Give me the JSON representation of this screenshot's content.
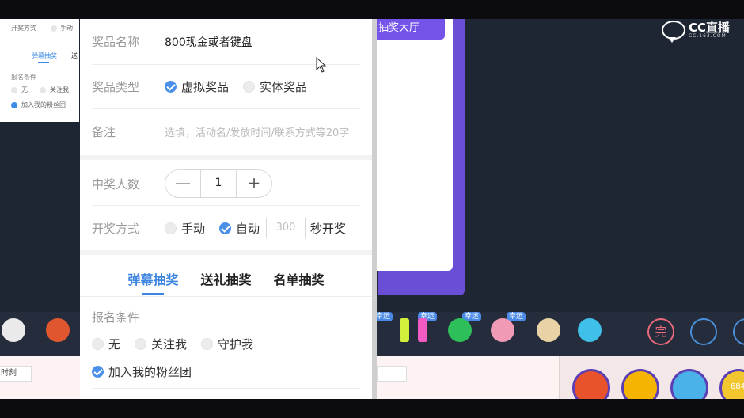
{
  "background_left": {
    "method_label": "开奖方式",
    "method_manual": "手动",
    "tab_active": "弹幕抽奖",
    "tab_next": "送",
    "cond_title": "报名条件",
    "cond_none": "无",
    "cond_follow": "关注我",
    "cond_fans": "加入我的粉丝团"
  },
  "background_right": {
    "hall_button": "抽奖大厅",
    "logo_brand": "CC直播",
    "logo_sub": "CC.163.COM"
  },
  "gift_strip": {
    "tags": [
      "幸运",
      "幸运",
      "幸运",
      "幸运",
      "幸运"
    ],
    "icon_wan": "完",
    "time_field": "时刻",
    "round_count": "684"
  },
  "modal": {
    "prize_name": {
      "label": "奖品名称",
      "value": "800现金或者键盘"
    },
    "prize_type": {
      "label": "奖品类型",
      "options": [
        "虚拟奖品",
        "实体奖品"
      ],
      "selected": "虚拟奖品"
    },
    "note": {
      "label": "备注",
      "placeholder": "选填，活动名/发放时间/联系方式等20字"
    },
    "winners": {
      "label": "中奖人数",
      "minus": "—",
      "value": "1",
      "plus": "+"
    },
    "draw_method": {
      "label": "开奖方式",
      "manual": "手动",
      "auto": "自动",
      "seconds_placeholder": "300",
      "seconds_suffix": "秒开奖",
      "selected": "自动"
    },
    "tabs": [
      "弹幕抽奖",
      "送礼抽奖",
      "名单抽奖"
    ],
    "active_tab": "弹幕抽奖",
    "conditions": {
      "title": "报名条件",
      "none": "无",
      "follow": "关注我",
      "guard": "守护我",
      "fans": "加入我的粉丝团",
      "selected": "加入我的粉丝团"
    }
  },
  "colors": {
    "accent": "#4a90e8",
    "purple": "#7353e8",
    "dark_bg": "#1e2533"
  }
}
